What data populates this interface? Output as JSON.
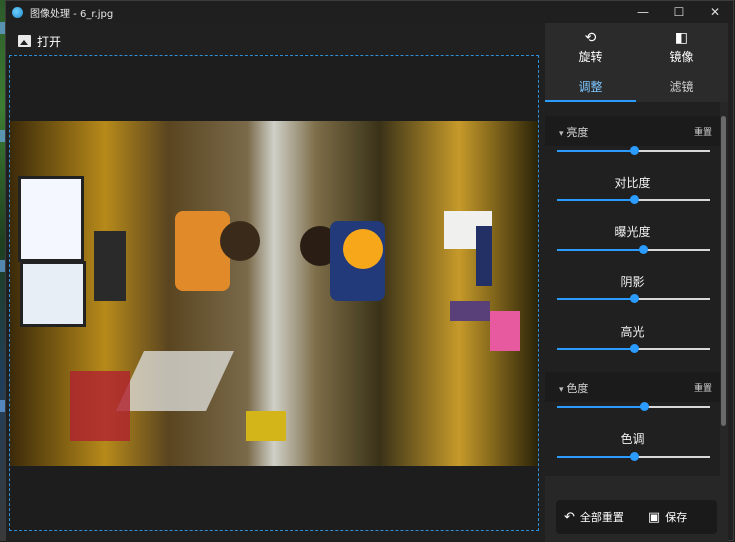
{
  "window": {
    "title": "图像处理 - 6_r.jpg",
    "controls": {
      "minimize": "—",
      "maximize": "☐",
      "close": "✕"
    }
  },
  "toolbar": {
    "open_label": "打开"
  },
  "panel": {
    "tools": [
      {
        "label": "旋转",
        "icon": "rotate-icon",
        "glyph": "⟲"
      },
      {
        "label": "镜像",
        "icon": "mirror-icon",
        "glyph": "◧"
      }
    ],
    "tabs": [
      {
        "label": "调整",
        "active": true
      },
      {
        "label": "滤镜",
        "active": false
      }
    ],
    "sections": [
      {
        "title": "亮度",
        "reset": "重置",
        "brightness_level": 0.5,
        "items": [
          {
            "label": "对比度",
            "level": 0.5
          },
          {
            "label": "曝光度",
            "level": 0.56
          },
          {
            "label": "阴影",
            "level": 0.5
          },
          {
            "label": "高光",
            "level": 0.5
          }
        ]
      },
      {
        "title": "色度",
        "reset": "重置",
        "color_level": 0.57,
        "items": [
          {
            "label": "色调",
            "level": 0.5
          }
        ]
      }
    ],
    "footer": {
      "reset_all": "全部重置",
      "save": "保存"
    }
  },
  "colors": {
    "accent": "#2b9bff",
    "frame": "#2f8fd6",
    "background": "#202020"
  }
}
